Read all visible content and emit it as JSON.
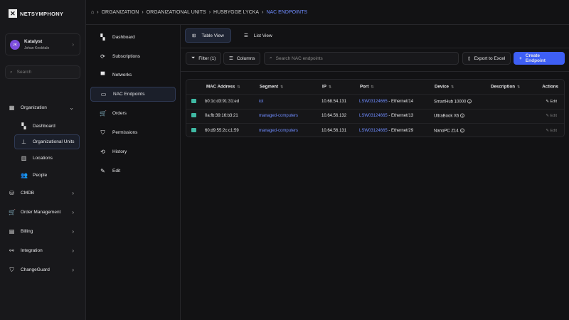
{
  "app": {
    "brand": "NETSYMPHONY"
  },
  "user": {
    "initials": "JK",
    "org": "Katalyst",
    "name": "Johan Keskitalo"
  },
  "search": {
    "placeholder": "Search"
  },
  "nav": [
    {
      "label": "Organization",
      "icon": "org-icon"
    },
    {
      "label": "Dashboard",
      "icon": "dashboard-icon"
    },
    {
      "label": "Organizational Units",
      "icon": "tree-icon"
    },
    {
      "label": "Locations",
      "icon": "map-icon"
    },
    {
      "label": "People",
      "icon": "people-icon"
    },
    {
      "label": "CMDB",
      "icon": "database-icon"
    },
    {
      "label": "Order Management",
      "icon": "cart-icon"
    },
    {
      "label": "Billing",
      "icon": "billing-icon"
    },
    {
      "label": "Integration",
      "icon": "integration-icon"
    },
    {
      "label": "ChangeGuard",
      "icon": "shield-icon"
    }
  ],
  "breadcrumb": [
    "ORGANIZATION",
    "ORGANIZATIONAL UNITS",
    "HUSBYGGE LYCKA",
    "NAC ENDPOINTS"
  ],
  "secnav": [
    "Dashboard",
    "Subscriptions",
    "Networks",
    "NAC Endpoints",
    "Orders",
    "Permissions",
    "History",
    "Edit"
  ],
  "views": {
    "table": "Table View",
    "list": "List View"
  },
  "toolbar": {
    "filter": "Filter (1)",
    "columns": "Columns",
    "search_placeholder": "Search NAC endpoints",
    "export": "Export to Excel",
    "create": "Create Endpoint"
  },
  "table": {
    "headers": [
      "MAC Address",
      "Segment",
      "IP",
      "Port",
      "Device",
      "Description",
      "Actions"
    ],
    "rows": [
      {
        "mac": "b0:1c:d3:91:31:ed",
        "segment": "iot",
        "ip": "10.68.54.131",
        "port_link": "LSW03124665",
        "port_rest": " - Ethernet/14",
        "device": "SmartHub 10000",
        "action": "Edit"
      },
      {
        "mac": "0a:fb:39:16:b3:21",
        "segment": "managed-computers",
        "ip": "10.64.56.132",
        "port_link": "LSW03124665",
        "port_rest": " - Ethernet/13",
        "device": "UltraBook X6",
        "action": "Edit"
      },
      {
        "mac": "60:d9:55:2c:c1:59",
        "segment": "managed-computers",
        "ip": "10.64.56.131",
        "port_link": "LSW03124665",
        "port_rest": " - Ethernet/29",
        "device": "NanoPC Z14",
        "action": "Edit"
      }
    ]
  }
}
